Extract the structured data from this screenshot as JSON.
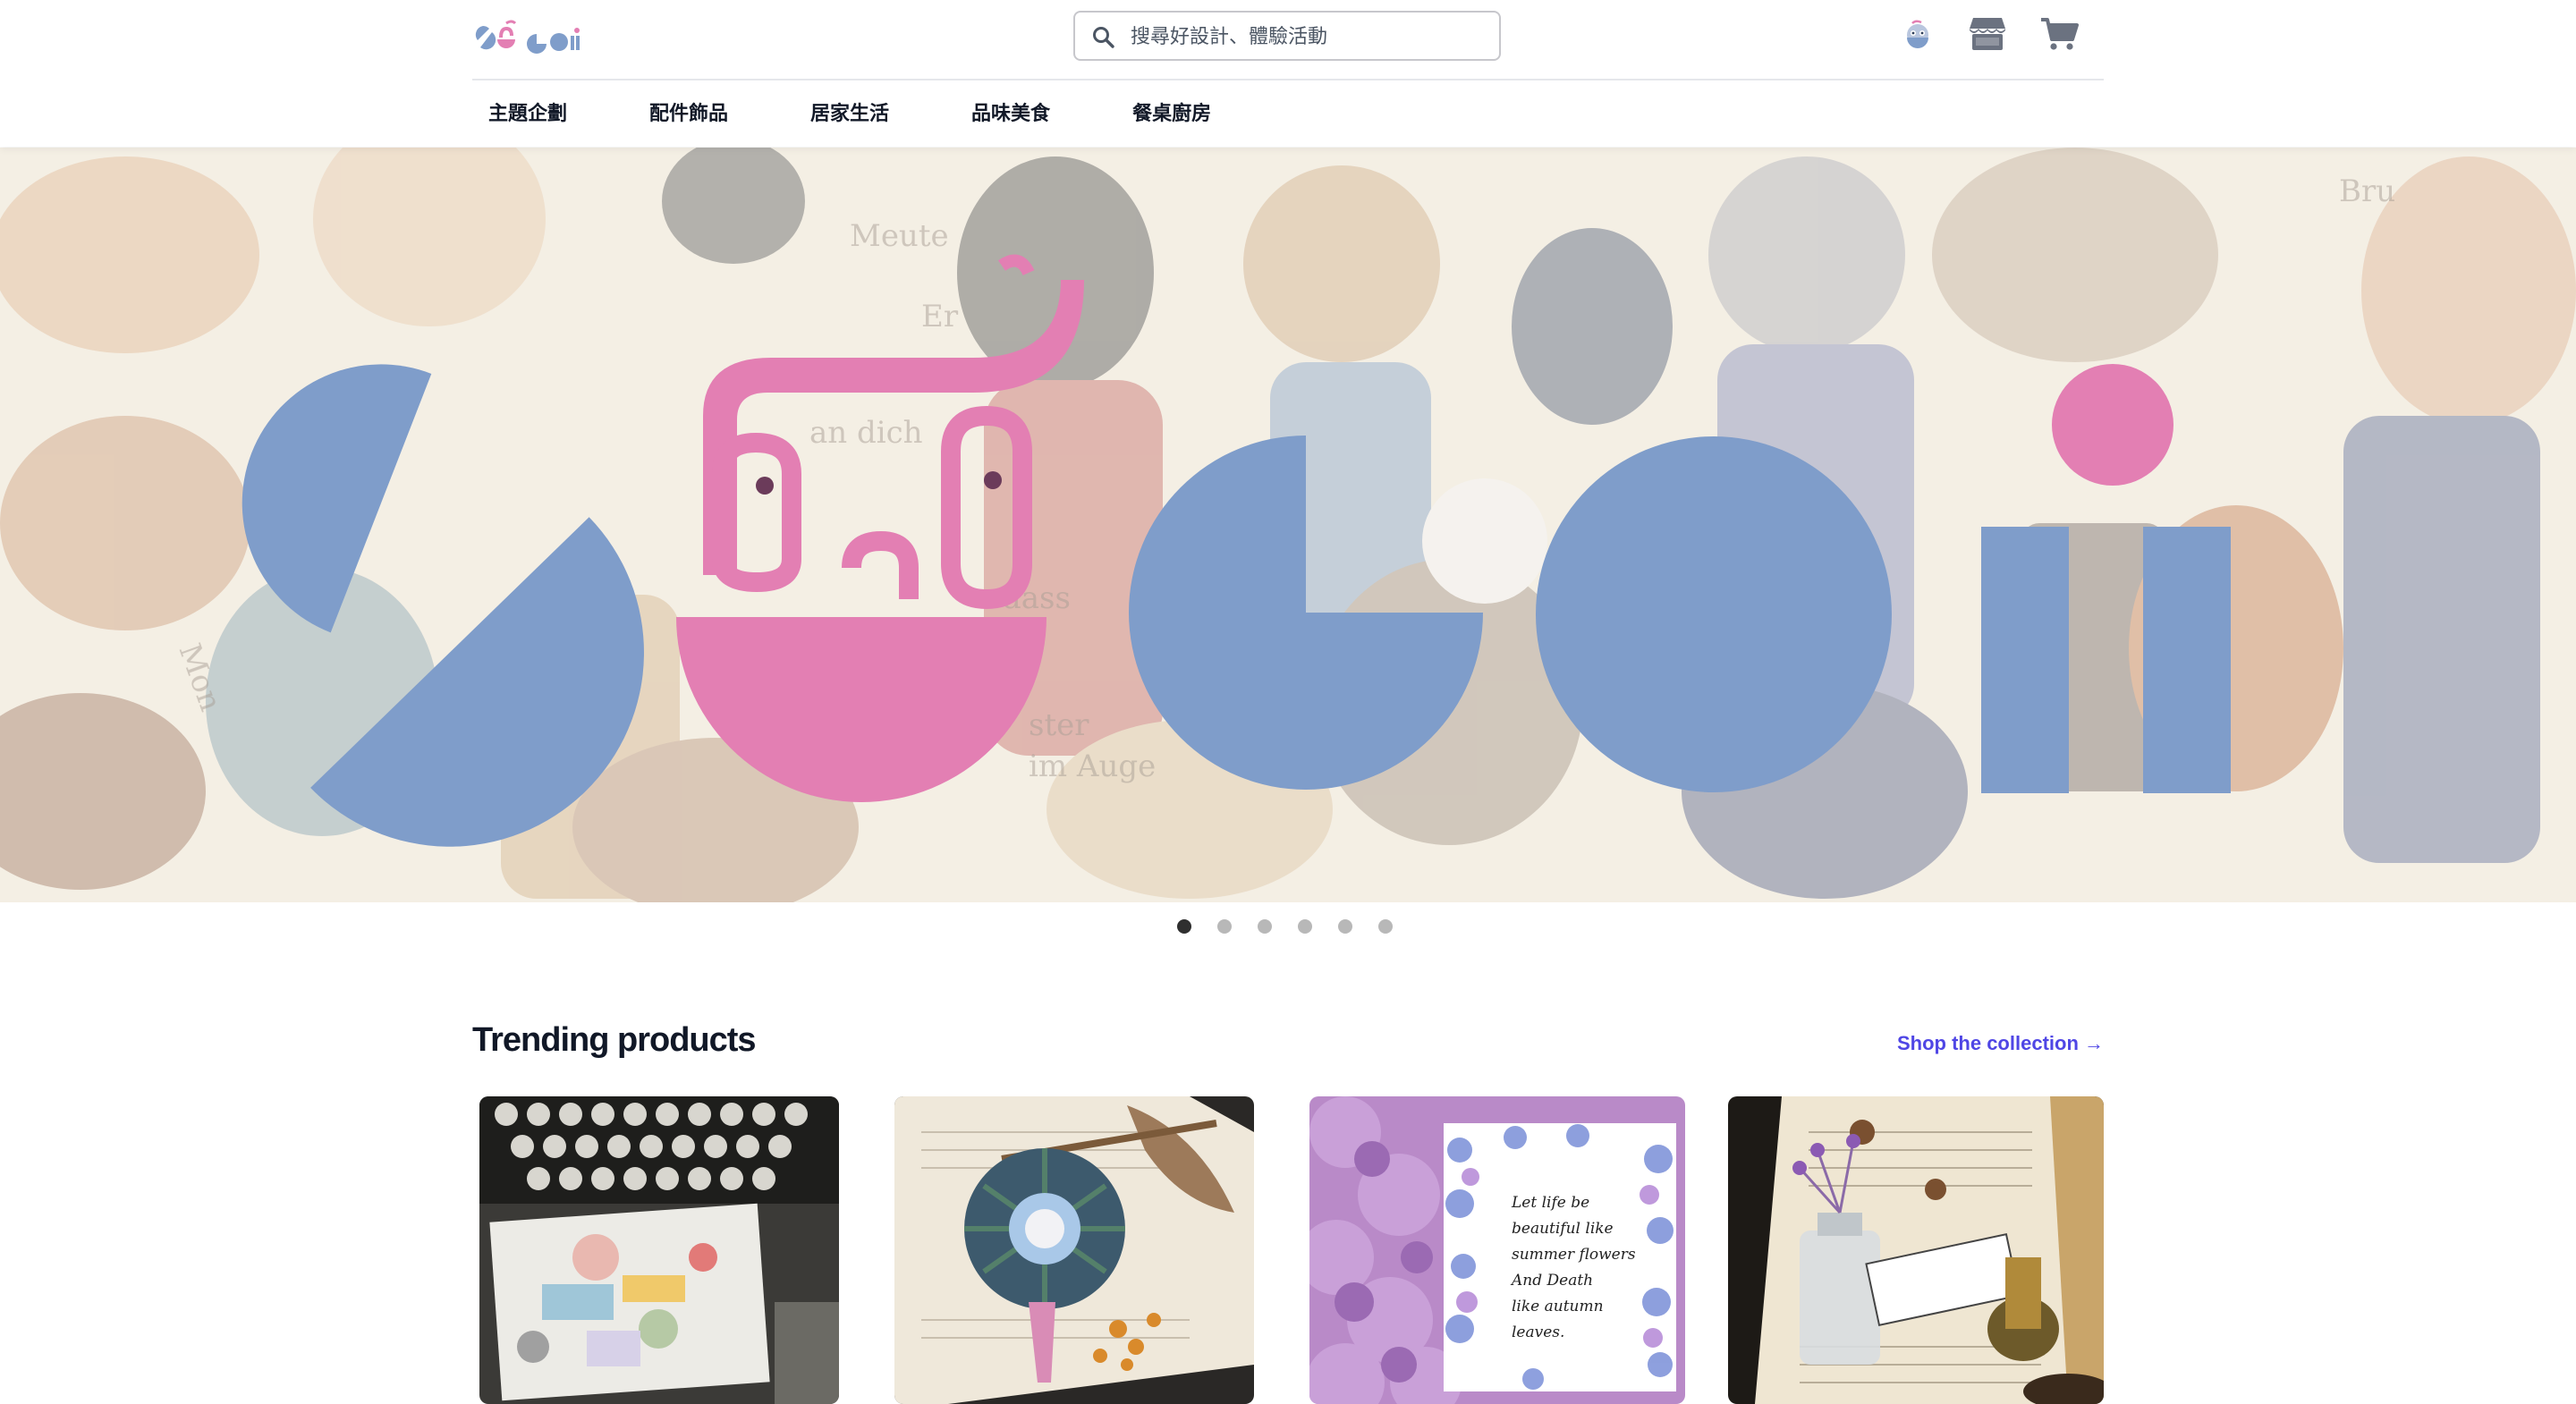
{
  "header": {
    "logo_text": "SuGoii",
    "search": {
      "placeholder": "搜尋好設計、體驗活動",
      "value": ""
    },
    "icons": [
      "search-icon",
      "user-avatar-icon",
      "store-icon",
      "cart-icon"
    ]
  },
  "nav": {
    "items": [
      {
        "label": "主題企劃"
      },
      {
        "label": "配件飾品"
      },
      {
        "label": "居家生活"
      },
      {
        "label": "品味美食"
      },
      {
        "label": "餐桌廚房"
      }
    ]
  },
  "hero": {
    "logo_text": "SuGoii",
    "slide_count": 6,
    "active_slide": 1,
    "background_texts": [
      "Meute",
      "Er",
      "an dich",
      "dass",
      "ster",
      "im Auge",
      "Bru",
      "Mon"
    ]
  },
  "trending": {
    "title": "Trending products",
    "link_label": "Shop the collection →",
    "products": [
      {
        "image": "typewriter-stickers"
      },
      {
        "image": "plaid-rosette"
      },
      {
        "image": "hydrangea-card",
        "card_text": [
          "Let life be",
          "beautiful like",
          "summer flowers",
          "And Death",
          "like autumn",
          "leaves."
        ]
      },
      {
        "image": "vintage-bottle"
      }
    ]
  },
  "colors": {
    "brand_blue": "#7f9dca",
    "brand_pink": "#e37fb3",
    "link": "#4f46e5",
    "text": "#111827"
  }
}
